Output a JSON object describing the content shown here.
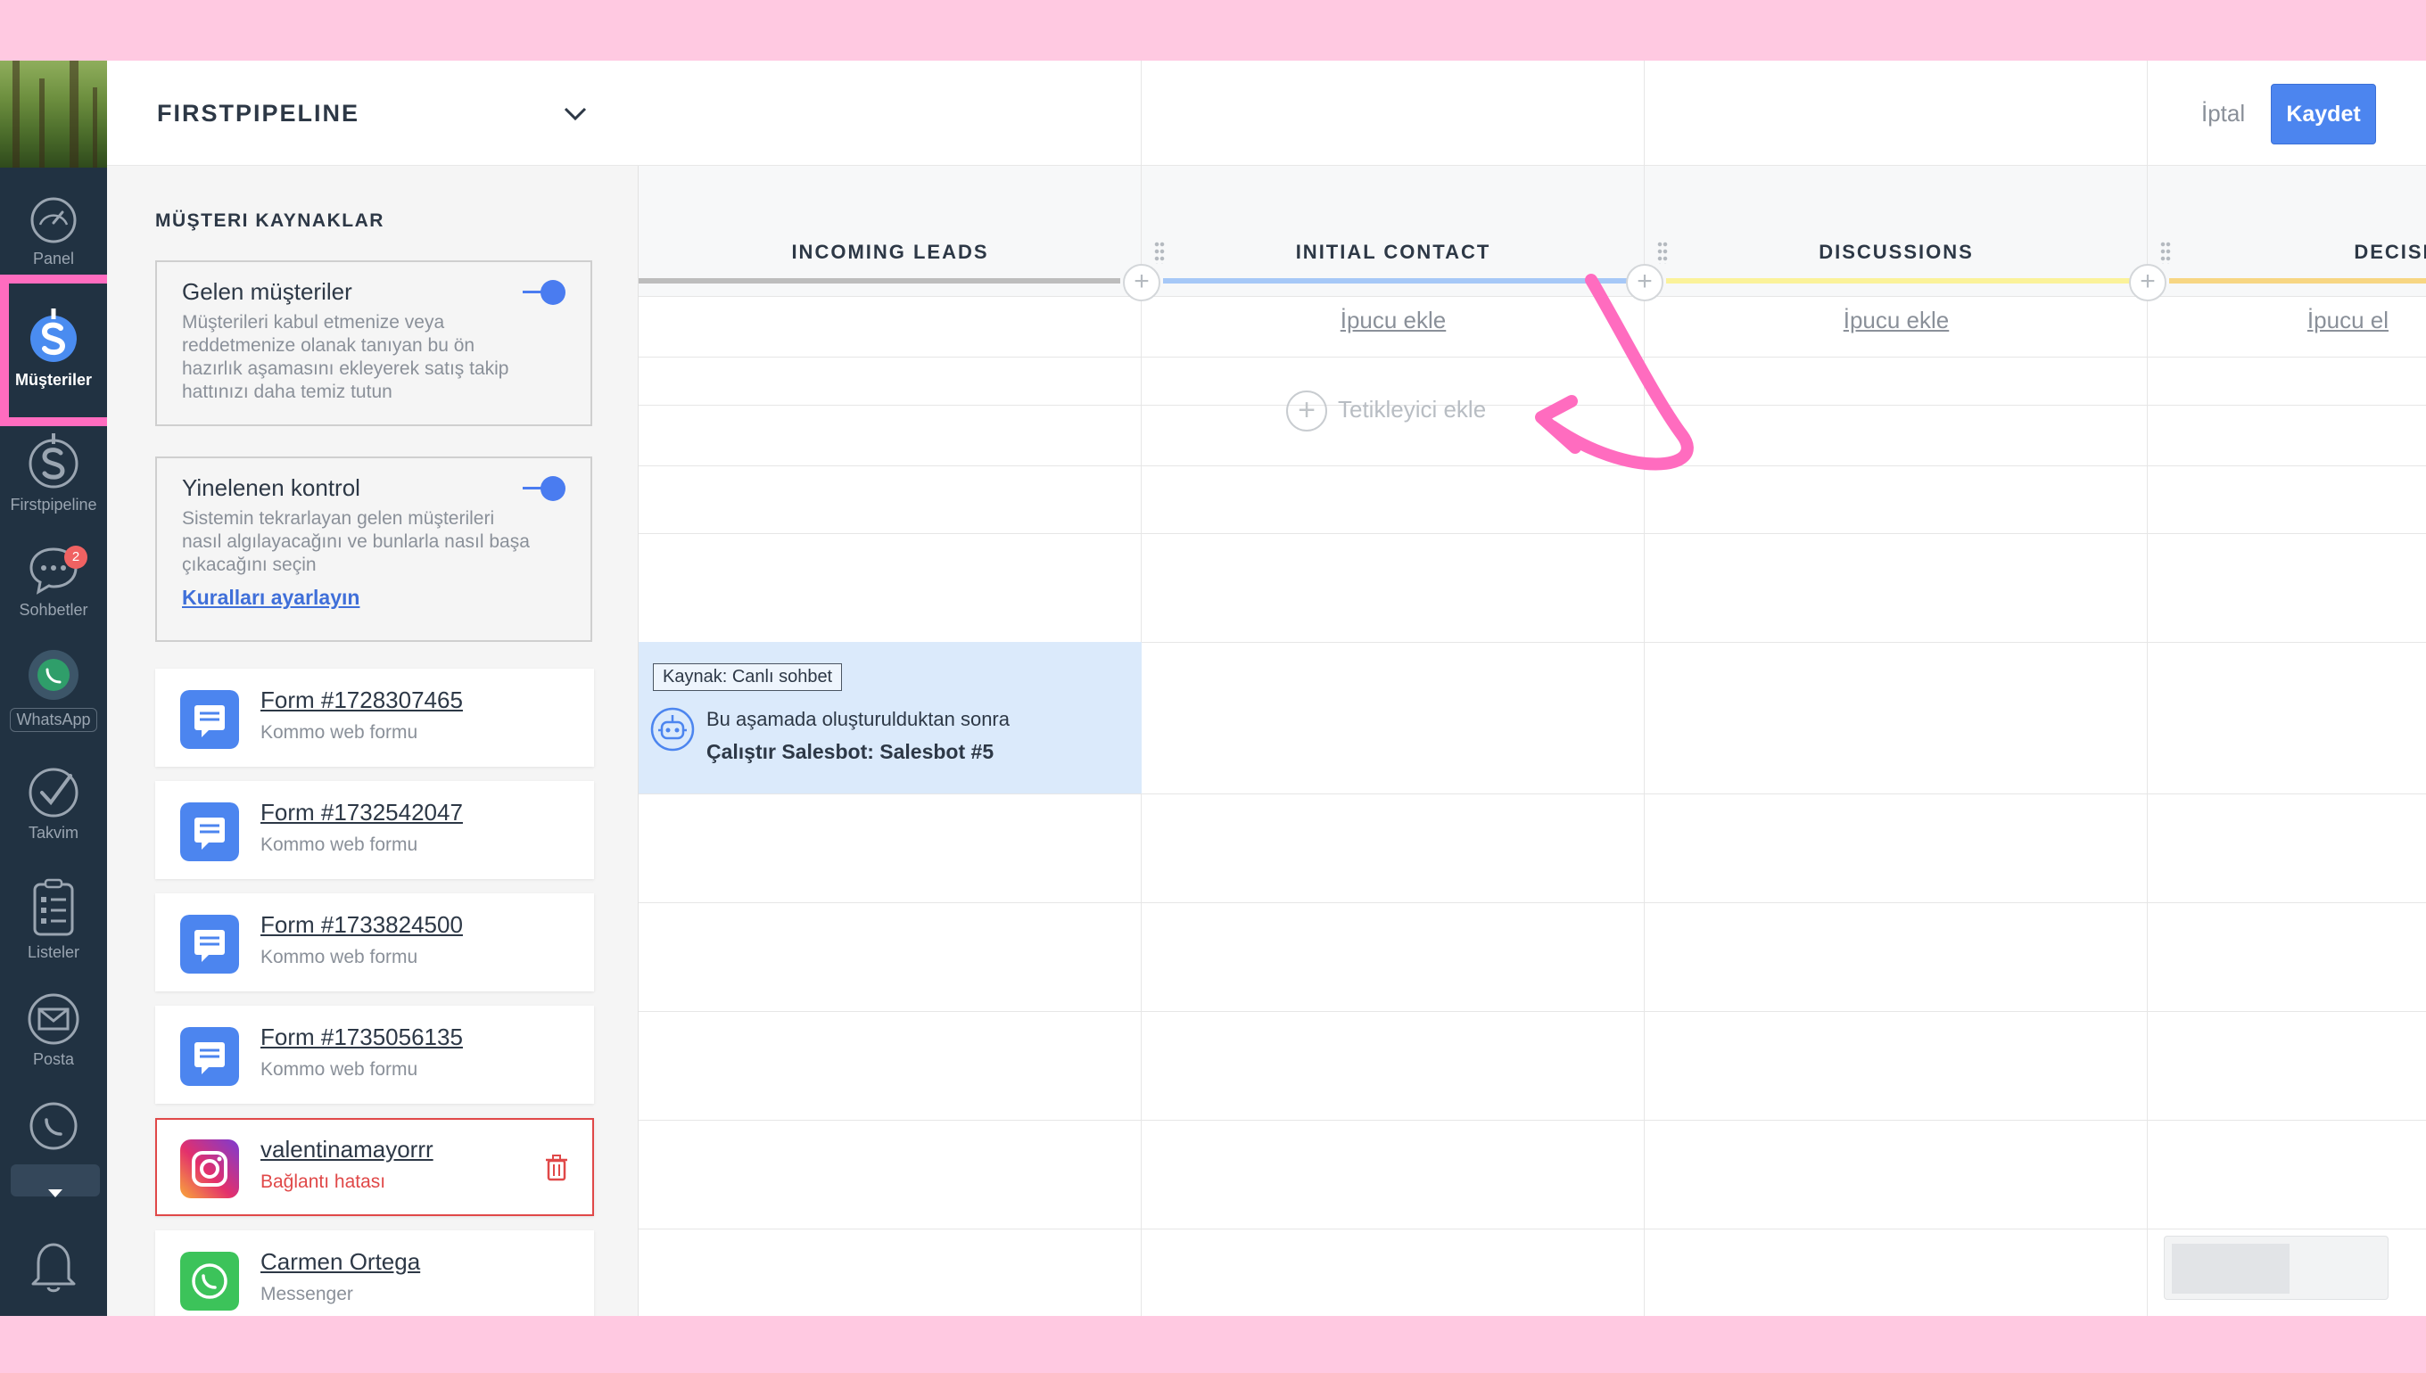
{
  "nav": {
    "items": [
      {
        "label": "Panel",
        "icon": "speedometer-icon"
      },
      {
        "label": "Müşteriler",
        "icon": "dollar-icon",
        "active": true
      },
      {
        "label": "Firstpipeline",
        "icon": "dollar-icon"
      },
      {
        "label": "Sohbetler",
        "icon": "chat-icon",
        "badge": "2"
      },
      {
        "label": "WhatsApp",
        "icon": "whatsapp-icon"
      },
      {
        "label": "Takvim",
        "icon": "check-icon"
      },
      {
        "label": "Listeler",
        "icon": "list-icon"
      },
      {
        "label": "Posta",
        "icon": "mail-icon"
      },
      {
        "label": "",
        "icon": "whatsapp-icon"
      },
      {
        "label": "",
        "icon": "bell-icon"
      }
    ]
  },
  "sidebar": {
    "pipeline_title": "FIRSTPIPELINE",
    "section_title": "MÜŞTERI KAYNAKLAR",
    "boxes": [
      {
        "title": "Gelen müşteriler",
        "desc": "Müşterileri kabul etmenize veya reddetmenize olanak tanıyan bu ön hazırlık aşamasını ekleyerek satış takip hattınızı daha temiz tutun",
        "enabled": true
      },
      {
        "title": "Yinelenen kontrol",
        "desc": "Sistemin tekrarlayan gelen müşterileri nasıl algılayacağını ve bunlarla nasıl başa çıkacağını seçin",
        "link": "Kuralları ayarlayın",
        "enabled": true
      }
    ],
    "sources": [
      {
        "name": "Form #1728307465",
        "sub": "Kommo web formu",
        "type": "form"
      },
      {
        "name": "Form #1732542047",
        "sub": "Kommo web formu",
        "type": "form"
      },
      {
        "name": "Form #1733824500",
        "sub": "Kommo web formu",
        "type": "form"
      },
      {
        "name": "Form #1735056135",
        "sub": "Kommo web formu",
        "type": "form"
      },
      {
        "name": "valentinamayorrr",
        "sub": "Bağlantı hatası",
        "type": "instagram",
        "error": true
      },
      {
        "name": "Carmen Ortega",
        "sub": "Messenger",
        "type": "whatsapp"
      }
    ]
  },
  "toolbar": {
    "cancel_label": "İptal",
    "save_label": "Kaydet"
  },
  "board": {
    "columns": [
      {
        "name": "INCOMING LEADS",
        "color": "#bdbdbd",
        "tip": ""
      },
      {
        "name": "INITIAL CONTACT",
        "color": "#a6c8f7",
        "tip": "İpucu ekle"
      },
      {
        "name": "DISCUSSIONS",
        "color": "#fbf29a",
        "tip": "İpucu ekle"
      },
      {
        "name": "DECISION MA",
        "color": "#f7d683",
        "tip": "İpucu el"
      }
    ],
    "add_trigger_label": "Tetikleyici ekle",
    "salesbot": {
      "tag": "Kaynak: Canlı sohbet",
      "line1": "Bu aşamada oluşturulduktan sonra",
      "line2": "Çalıştır Salesbot: Salesbot #5"
    }
  },
  "colors": {
    "accent": "#4c85ef",
    "highlight": "#ff6cbf",
    "nav_bg": "#213242",
    "error": "#e04848"
  }
}
